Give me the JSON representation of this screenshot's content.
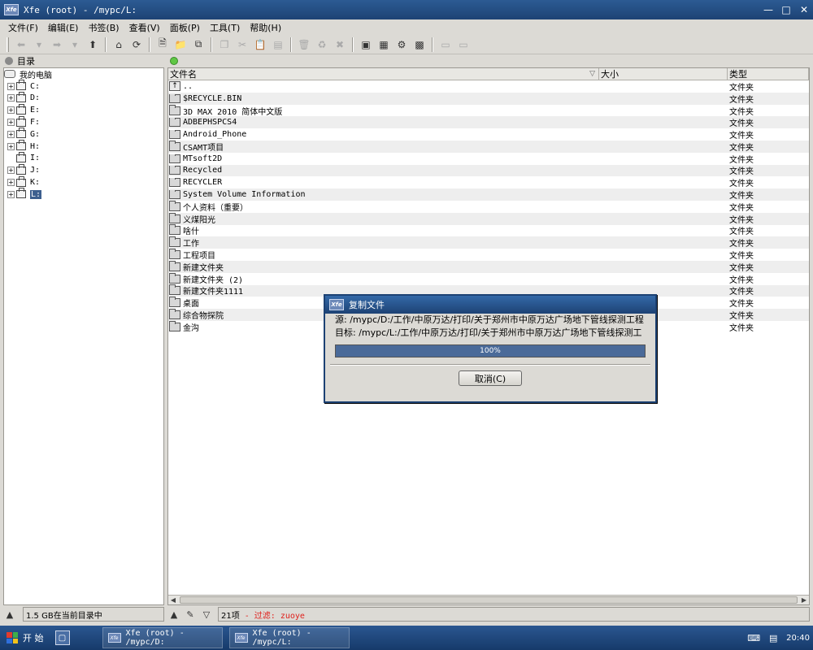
{
  "window": {
    "title": "Xfe (root) - /mypc/L:",
    "app_icon": "xfe-icon",
    "controls": [
      "minimize-icon",
      "maximize-icon",
      "close-icon"
    ]
  },
  "menu": [
    "文件(F)",
    "编辑(E)",
    "书签(B)",
    "查看(V)",
    "面板(P)",
    "工具(T)",
    "帮助(H)"
  ],
  "left_pane": {
    "header": "目录",
    "root": "我的电脑",
    "drives": [
      {
        "label": "C:",
        "expandable": true
      },
      {
        "label": "D:",
        "expandable": true
      },
      {
        "label": "E:",
        "expandable": true
      },
      {
        "label": "F:",
        "expandable": true
      },
      {
        "label": "G:",
        "expandable": true
      },
      {
        "label": "H:",
        "expandable": true
      },
      {
        "label": "I:",
        "expandable": false
      },
      {
        "label": "J:",
        "expandable": true
      },
      {
        "label": "K:",
        "expandable": true
      },
      {
        "label": "L:",
        "expandable": true,
        "selected": true
      }
    ],
    "status": "1.5 GB在当前目录中"
  },
  "file_list": {
    "columns": {
      "name": "文件名",
      "size": "大小",
      "type": "类型"
    },
    "rows": [
      {
        "name": "..",
        "type": "文件夹",
        "up": true
      },
      {
        "name": "$RECYCLE.BIN",
        "type": "文件夹"
      },
      {
        "name": "3D MAX 2010 简体中文版",
        "type": "文件夹"
      },
      {
        "name": "ADBEPHSPCS4",
        "type": "文件夹"
      },
      {
        "name": "Android_Phone",
        "type": "文件夹"
      },
      {
        "name": "CSAMT项目",
        "type": "文件夹"
      },
      {
        "name": "MTsoft2D",
        "type": "文件夹"
      },
      {
        "name": "Recycled",
        "type": "文件夹"
      },
      {
        "name": "RECYCLER",
        "type": "文件夹"
      },
      {
        "name": "System Volume Information",
        "type": "文件夹"
      },
      {
        "name": "个人资料（重要）",
        "type": "文件夹"
      },
      {
        "name": "义煤阳光",
        "type": "文件夹"
      },
      {
        "name": "啥什",
        "type": "文件夹"
      },
      {
        "name": "工作",
        "type": "文件夹"
      },
      {
        "name": "工程项目",
        "type": "文件夹"
      },
      {
        "name": "新建文件夹",
        "type": "文件夹"
      },
      {
        "name": "新建文件夹 (2)",
        "type": "文件夹"
      },
      {
        "name": "新建文件夹1111",
        "type": "文件夹"
      },
      {
        "name": "桌面",
        "type": "文件夹"
      },
      {
        "name": "综合物探院",
        "type": "文件夹"
      },
      {
        "name": "金沟",
        "type": "文件夹"
      }
    ],
    "status_count": "21项",
    "status_filter": "- 过滤: zuoye"
  },
  "dialog": {
    "title": "复制文件",
    "source": "源: /mypc/D:/工作/中原万达/打印/关于郑州市中原万达广场地下管线探测工程",
    "target": "目标: /mypc/L:/工作/中原万达/打印/关于郑州市中原万达广场地下管线探测工",
    "progress_text": "100%",
    "progress_value": 100,
    "cancel_label": "取消(C)"
  },
  "taskbar": {
    "start_label": "开 始",
    "tasks": [
      "Xfe (root) - /mypc/D:",
      "Xfe (root) - /mypc/L:"
    ],
    "clock": "20:40"
  }
}
